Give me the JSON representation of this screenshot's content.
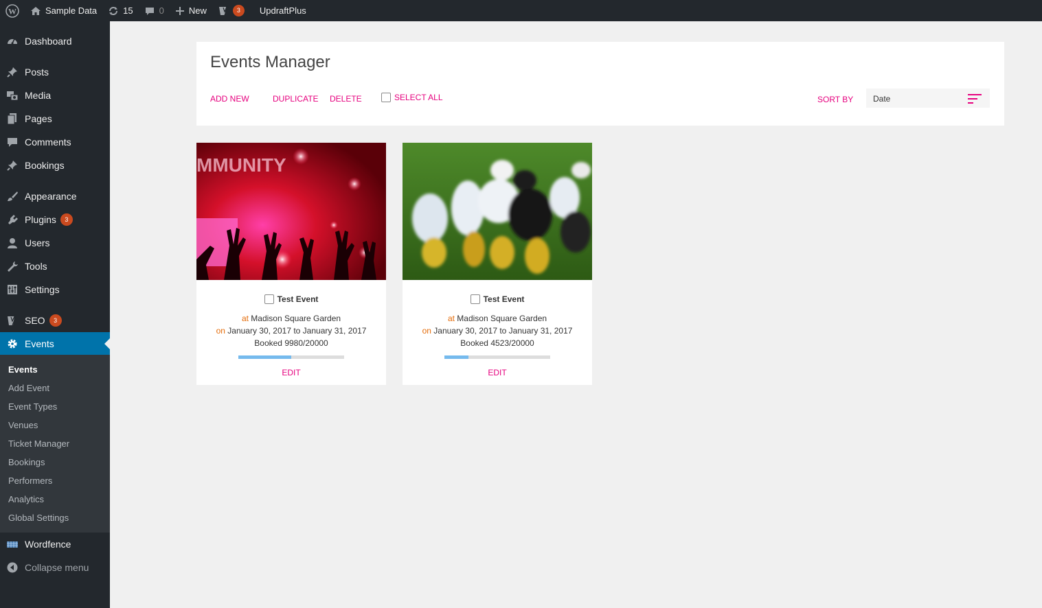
{
  "adminbar": {
    "site_name": "Sample Data",
    "updates_count": "15",
    "comments_count": "0",
    "new_label": "New",
    "seo_badge": "3",
    "updraft_label": "UpdraftPlus"
  },
  "sidebar": {
    "items": [
      {
        "label": "Dashboard",
        "icon": "dashboard-icon"
      },
      {
        "label": "Posts",
        "icon": "pin-icon"
      },
      {
        "label": "Media",
        "icon": "media-icon"
      },
      {
        "label": "Pages",
        "icon": "pages-icon"
      },
      {
        "label": "Comments",
        "icon": "comment-icon"
      },
      {
        "label": "Bookings",
        "icon": "pin-icon"
      },
      {
        "label": "Appearance",
        "icon": "brush-icon"
      },
      {
        "label": "Plugins",
        "icon": "plugin-icon",
        "badge": "3"
      },
      {
        "label": "Users",
        "icon": "user-icon"
      },
      {
        "label": "Tools",
        "icon": "wrench-icon"
      },
      {
        "label": "Settings",
        "icon": "settings-icon"
      },
      {
        "label": "SEO",
        "icon": "yoast-icon",
        "badge": "3"
      },
      {
        "label": "Events",
        "icon": "gear-icon"
      }
    ],
    "submenu": [
      "Events",
      "Add Event",
      "Event Types",
      "Venues",
      "Ticket Manager",
      "Bookings",
      "Performers",
      "Analytics",
      "Global Settings"
    ],
    "wordfence": "Wordfence",
    "collapse": "Collapse menu"
  },
  "main": {
    "title": "Events Manager",
    "actions": {
      "add_new": "ADD NEW",
      "duplicate": "DUPLICATE",
      "delete": "DELETE",
      "select_all": "SELECT ALL"
    },
    "sort_by_label": "SORT BY",
    "sort_value": "Date"
  },
  "events": [
    {
      "title": "Test Event",
      "at_label": "at",
      "venue": "Madison Square Garden",
      "on_label": "on",
      "dates": "January 30, 2017 to January 31, 2017",
      "booked": "Booked 9980/20000",
      "progress": 0.499,
      "edit_label": "EDIT",
      "image_text": "MMUNITY"
    },
    {
      "title": "Test Event",
      "at_label": "at",
      "venue": "Madison Square Garden",
      "on_label": "on",
      "dates": "January 30, 2017 to January 31, 2017",
      "booked": "Booked 4523/20000",
      "progress": 0.226,
      "edit_label": "EDIT"
    }
  ],
  "colors": {
    "accent": "#e6007e",
    "highlight": "#e46c0a",
    "admin_dark": "#23282d",
    "active_blue": "#0073aa",
    "progress_fill": "#75baed"
  }
}
